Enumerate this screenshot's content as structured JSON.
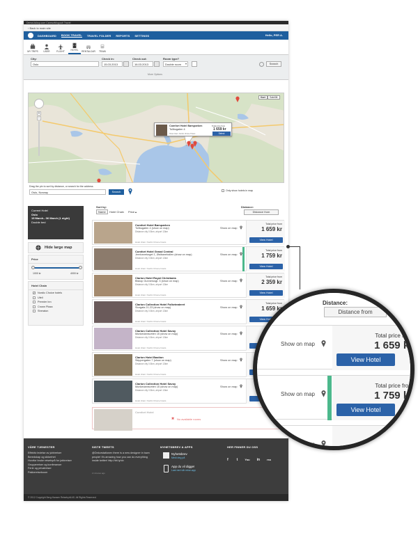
{
  "topbar": {
    "text": "DemoUkAsp.com Caresoft/logout/ Travel"
  },
  "back_link": "‹ Back to main site",
  "nav": {
    "items": [
      "DASHBOARD",
      "BOOK TRAVEL",
      "TRAVEL FOLDER",
      "REPORTS",
      "SETTINGS"
    ],
    "user": "Hello, PER A."
  },
  "subnav": {
    "items": [
      "MY TRIPS",
      "USER",
      "FLIGHT",
      "HOTEL",
      "RENTALCAR",
      "TRAIN"
    ]
  },
  "search": {
    "city_label": "City:",
    "city_value": "Oslo",
    "checkin_label": "Check in:",
    "checkin_value": "15.03.2013",
    "checkout_label": "Check out:",
    "checkout_value": "16.03.2013",
    "roomtype_label": "Room type?",
    "roomtype_value": "Double room",
    "select_button": "Select",
    "more_options": "More Options",
    "search_button": "Search"
  },
  "map": {
    "tabs": [
      "Kart",
      "Satellitt"
    ],
    "popup_name": "Comfort Hotel Børsparken",
    "popup_addr": "Tollbugaten 4",
    "popup_chain": "Hotel chain: Nordic Choice Hotels",
    "popup_price_title": "Total price from",
    "popup_price": "1 659 kr",
    "popup_select": "Select",
    "drag_label": "Drag the pin to sort by distance, or search for the address",
    "location_value": "Oslo, Norway",
    "location_search": "Search",
    "only_show": "Only show hotels in map"
  },
  "sidebar": {
    "current_title": "Current Hotel",
    "current_city": "Oslo",
    "current_dates": "15 March– 06 March (1 night)",
    "current_room": "Double bed",
    "hide_map": "Hide large map",
    "price_title": "Price",
    "price_min": "1000 kr",
    "price_max": "4000 kr",
    "price_range": [
      0.0,
      1.0
    ],
    "chain_title": "Hotel Chain",
    "chains": [
      {
        "label": "Nordic Choice hotels",
        "checked": true
      },
      {
        "label": "Ufell",
        "checked": false
      },
      {
        "label": "Premier Inn",
        "checked": false
      },
      {
        "label": "Crown Plaza",
        "checked": false
      },
      {
        "label": "Sheraton",
        "checked": false
      }
    ]
  },
  "sort": {
    "label": "Sort by:",
    "options": [
      "Name",
      "Hotel Chain",
      "Price"
    ],
    "distance_label": "Distance:",
    "distance_value": "Distance from"
  },
  "results": [
    {
      "name": "Comfort Hotel Børsparken",
      "addr": "Tollbugaten 4 (show on map)",
      "dist": "Distance city 0.5km, airport 13km",
      "chain": "Hotel chain: Nordic Choice hotels",
      "show_map": "Show on map",
      "price_title": "Total price from",
      "price": "1 659 kr",
      "button": "View Hotel",
      "selected": false
    },
    {
      "name": "Comfort Hotel Grand Central",
      "addr": "Jernbanetorget 1, Østbanehallen (show on map)",
      "dist": "Distance city 0.5km, airport 13km",
      "chain": "Hotel chain: Nordic Choice hotels",
      "show_map": "Show on map",
      "price_title": "Total price from",
      "price": "1 759 kr",
      "button": "View Hotel",
      "selected": true
    },
    {
      "name": "Clarion Hotel Royal Christiania",
      "addr": "Biskop Gunnerusgt. 3 (show on map)",
      "dist": "Distance city 0.5km, airport 13km",
      "chain": "Hotel chain: Nordic Choice hotels",
      "show_map": "Show on map",
      "price_title": "Total price from",
      "price": "2 359 kr",
      "button": "View Hotel",
      "selected": false
    },
    {
      "name": "Clarion Collection Hotel Folketeateret",
      "addr": "Storgata 21-23 (show on map)",
      "dist": "Distance city 0.5km, airport 13km",
      "chain": "Hotel chain: Nordic Choice hotels",
      "show_map": "Show on map",
      "price_title": "Total price from",
      "price": "1 659 kr",
      "button": "View Hotel",
      "selected": false
    },
    {
      "name": "Clarion Collection Hotel Savoy",
      "addr": "Munkedamsveien 15 (show on map)",
      "dist": "Distance city 0.5km, airport 13km",
      "chain": "Hotel chain: Nordic Choice hotels",
      "show_map": "Show on map",
      "price_title": "Total price from",
      "price": "1 759 kr",
      "button": "View Hotel",
      "selected": false
    },
    {
      "name": "Clarion Hotel Bastion",
      "addr": "Skippergaten 7 (show on map)",
      "dist": "Distance city 0.5km, airport 13km",
      "chain": "Hotel chain: Nordic Choice hotels",
      "show_map": "Show on map",
      "price_title": "Total price from",
      "price": "1 659 kr",
      "button": "View Hotel",
      "selected": false
    },
    {
      "name": "Clarion Collection Hotel Savoy",
      "addr": "Munkedamsveien 15 (show on map)",
      "dist": "Distance city 0.5km, airport 13km",
      "chain": "Hotel chain: Nordic Choice hotels",
      "show_map": "Show on map",
      "price_title": "Total price from",
      "price": "1 759 kr",
      "button": "View Hotel",
      "selected": false
    }
  ],
  "unavailable": {
    "name": "Comfort Hotel",
    "message": "No available rooms"
  },
  "footer": {
    "col1_title": "VÅRE TJENESTER",
    "col1_links": [
      "Effektiv ledelse av jobbreiser",
      "Beredskap og sikkerhet",
      "Hvorfor bruke reisebyrå for jobbreiser",
      "Gruppereiser og konferanser",
      "Ferie og privatreiser",
      "Pakkereiseboom"
    ],
    "col2_title": "SISTE TWEETS",
    "col2_tweet": "@Dekorstationen there is a new designer in town people! It's amazing how you can do everything inside twitter! http://bit.ly/cb",
    "col2_time": "2 minutes ago",
    "col3_title": "NYHETSBREV & APPS",
    "col3_news_title": "Nyhetsbrev",
    "col3_news_sub": "Meld deg på",
    "col3_app_title": "App du vil digge!",
    "col3_app_sub": "Last ned vår reise-app",
    "col4_title": "HER FINNER DU OSS",
    "social": [
      "f",
      "t",
      "You",
      "in",
      "rss"
    ]
  },
  "copyright": "© 2012 Copyright Berg-Hansen Reisebyrå AS. All Rights Reserved.",
  "magnifier": {
    "distance_label": "Distance:",
    "distance_value": "Distance from",
    "rows": [
      {
        "show_map": "Show on map",
        "price_title": "Total price from",
        "price": "1 659 kr",
        "button": "View Hotel",
        "selected": false
      },
      {
        "show_map": "Show on map",
        "price_title": "Total price from",
        "price": "1 759 kr",
        "button": "View Hotel",
        "selected": true
      },
      {
        "show_map": "Show on map",
        "price_title": "",
        "price": "2 35",
        "button": "",
        "selected": false
      }
    ]
  },
  "colors": {
    "brand": "#1f5f9e",
    "button": "#2b62a8",
    "selected": "#4cb88c",
    "footer": "#3d3d3d"
  }
}
